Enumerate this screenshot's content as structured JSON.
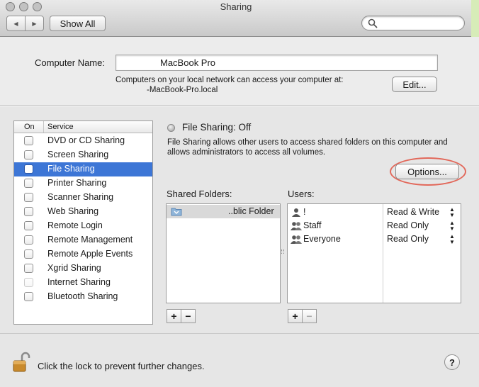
{
  "window": {
    "title": "Sharing"
  },
  "toolbar": {
    "show_all_label": "Show All",
    "back_arrow": "◀",
    "forward_arrow": "▶",
    "search_placeholder": ""
  },
  "computer": {
    "label": "Computer Name:",
    "value": "MacBook Pro",
    "info_line": "Computers on your local network can access your computer at:",
    "address": "-MacBook-Pro.local",
    "edit_label": "Edit..."
  },
  "services": {
    "col_on": "On",
    "col_service": "Service",
    "items": [
      {
        "label": "DVD or CD Sharing",
        "checked": false
      },
      {
        "label": "Screen Sharing",
        "checked": false
      },
      {
        "label": "File Sharing",
        "checked": false,
        "selected": true
      },
      {
        "label": "Printer Sharing",
        "checked": false
      },
      {
        "label": "Scanner Sharing",
        "checked": false
      },
      {
        "label": "Web Sharing",
        "checked": false
      },
      {
        "label": "Remote Login",
        "checked": false
      },
      {
        "label": "Remote Management",
        "checked": false
      },
      {
        "label": "Remote Apple Events",
        "checked": false
      },
      {
        "label": "Xgrid Sharing",
        "checked": false
      },
      {
        "label": "Internet Sharing",
        "checked": false,
        "disabled": true
      },
      {
        "label": "Bluetooth Sharing",
        "checked": false
      }
    ]
  },
  "file_sharing": {
    "status": "File Sharing: Off",
    "description": "File Sharing allows other users to access shared folders on this computer and allows administrators to access all volumes.",
    "options_label": "Options..."
  },
  "shared_folders": {
    "label": "Shared Folders:",
    "items": [
      "..blic Folder"
    ]
  },
  "users": {
    "label": "Users:",
    "rows": [
      {
        "name": "!",
        "permission": "Read & Write",
        "icon": "single-user-icon"
      },
      {
        "name": "Staff",
        "permission": "Read Only",
        "icon": "group-icon"
      },
      {
        "name": "Everyone",
        "permission": "Read Only",
        "icon": "group-icon"
      }
    ]
  },
  "buttons": {
    "plus": "+",
    "minus": "−"
  },
  "footer": {
    "lock_text": "Click the lock to prevent further changes.",
    "help": "?"
  },
  "colors": {
    "selection": "#3d76d6",
    "highlight_ring": "#e2685a"
  }
}
